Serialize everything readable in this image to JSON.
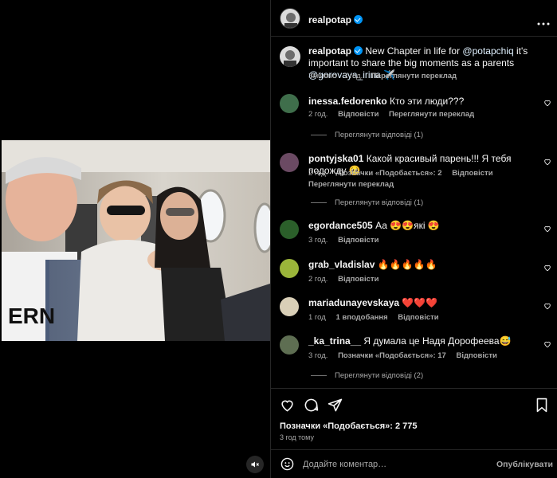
{
  "post": {
    "author": "realpotap",
    "caption_mention1": "@potapchiq",
    "caption_mention2": "@gorovaya_irina",
    "caption_part1": "New Chapter in life for",
    "caption_part2": "it's important to share the big moments as a parents",
    "caption_emoji": "✈️",
    "edited": "Змінено · 3 год.",
    "see_translation": "Переглянути переклад"
  },
  "comments": [
    {
      "user": "inessa.fedorenko",
      "text": "Кто эти люди???",
      "time": "2 год.",
      "reply": "Відповісти",
      "translate": "Переглянути переклад",
      "replies": "Переглянути відповіді (1)",
      "avatar_color": "#3f6e4b"
    },
    {
      "user": "pontyjska01",
      "text": "Какой красивый парень!!! Я тебя подожду 🥺",
      "time": "2 год.",
      "likes": "Позначки «Подобається»: 2",
      "reply": "Відповісти",
      "translate": "Переглянути переклад",
      "replies": "Переглянути відповіді (1)",
      "avatar_color": "#6b4a63"
    },
    {
      "user": "egordance505",
      "text": "Аа 😍😍які 😍",
      "time": "3 год.",
      "reply": "Відповісти",
      "avatar_color": "#2b5f2a"
    },
    {
      "user": "grab_vladislav",
      "text": "🔥🔥🔥🔥🔥",
      "time": "2 год.",
      "reply": "Відповісти",
      "avatar_color": "#9bb53a"
    },
    {
      "user": "mariadunayevskaya",
      "text": "❤️❤️❤️",
      "time": "1 год",
      "likes": "1 вподобання",
      "reply": "Відповісти",
      "avatar_color": "#d9cfb7"
    },
    {
      "user": "_ka_trina__",
      "text": "Я думала це Надя Дорофеева😅",
      "time": "3 год.",
      "likes": "Позначки «Подобається»: 17",
      "reply": "Відповісти",
      "replies": "Переглянути відповіді (2)",
      "avatar_color": "#5e6e52"
    }
  ],
  "footer": {
    "likes": "Позначки «Подобається»: 2 775",
    "time": "3 год тому",
    "add_comment_placeholder": "Додайте коментар…",
    "publish": "Опублікувати"
  },
  "icons": {
    "more": "more-horizontal-icon",
    "like": "heart-icon",
    "comment": "comment-icon",
    "share": "send-icon",
    "save": "bookmark-icon",
    "emoji": "emoji-icon",
    "mute": "speaker-muted-icon"
  },
  "colors": {
    "verified": "#0095f6",
    "mention": "#e0f1ff"
  }
}
